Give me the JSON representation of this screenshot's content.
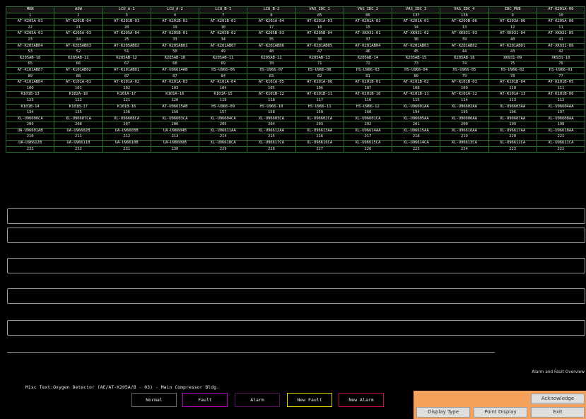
{
  "grid": {
    "rows": [
      [
        "MON",
        "ASW",
        "LCU_A-1",
        "LCU_A-2",
        "LCU_B-1",
        "LCU_B-2",
        "VAS_IDC_1",
        "VAS_IDC_2",
        "VAS_IDC_3",
        "VAS_IDC_4",
        "IDC_PUB",
        "AT-K201A-06"
      ],
      [
        "1",
        "2",
        "3",
        "4",
        "7",
        "8",
        "85",
        "86",
        "137",
        "138",
        "9",
        "10"
      ],
      [
        "AT-K205A-01",
        "AT-K201B-04",
        "AT-K201B-03",
        "AT-K201B-02",
        "AT-K201B-01",
        "AT-K201A-04",
        "AT-K201A-03",
        "AT-K201A-02",
        "AT-K201A-01",
        "AT-K203B-06",
        "AT-K203A-06",
        "AT-K205A-06"
      ],
      [
        "22",
        "21",
        "20",
        "19",
        "18",
        "17",
        "16",
        "15",
        "14",
        "13",
        "12",
        "11"
      ],
      [
        "AT-K205A-01",
        "AT-K205A-03",
        "AT-K205A-04",
        "AT-K205B-01",
        "AT-K205B-02",
        "AT-K205B-03",
        "AT-K205B-04",
        "AT-XK931-01",
        "AT-XK931-02",
        "AT-XK931-03",
        "AT-XK931-04",
        "AT-XK931-05"
      ],
      [
        "23",
        "24",
        "25",
        "33",
        "34",
        "35",
        "36",
        "37",
        "38",
        "39",
        "40",
        "41"
      ],
      [
        "AT-K205AB04",
        "AT-K205AB03",
        "AT-K205AB02",
        "AT-K205AB01",
        "AT-K201AB07",
        "AT-K201AB06",
        "AT-K201AB05",
        "AT-K201AB04",
        "AT-K201AB03",
        "AT-K201AB02",
        "AT-K201AB01",
        "AT-XK931-06"
      ],
      [
        "53",
        "52",
        "51",
        "50",
        "49",
        "48",
        "47",
        "46",
        "45",
        "44",
        "43",
        "42"
      ],
      [
        "K205AB-16",
        "K205AB-11",
        "K205AB-12",
        "K205AB-10",
        "K205AB-11",
        "K205AB-12",
        "K205AB-13",
        "K205AB-14",
        "K205AB-15",
        "K205AB-16",
        "XK931-09",
        "XK931-10"
      ],
      [
        "65",
        "66",
        "67",
        "68",
        "69",
        "70",
        "71",
        "72",
        "73",
        "74",
        "75",
        "76"
      ],
      [
        "AT-K101AB07",
        "AT-K101AB02",
        "AT-K101AB01",
        "AT-U96614AB",
        "HS-U966-06",
        "HS-U966-07",
        "HS-U966-08",
        "HS-U966-03",
        "HS-U966-04",
        "HS-U966-05",
        "HS-U966-02",
        "HS-U966-01"
      ],
      [
        "89",
        "88",
        "87",
        "87",
        "84",
        "83",
        "82",
        "81",
        "80",
        "79",
        "78",
        "77"
      ],
      [
        "AT-K101AB04",
        "AT-K101A-01",
        "AT-K101A-02",
        "AT-K101A-03",
        "AT-K101A-04",
        "AT-K101A-05",
        "AT-K101A-06",
        "AT-K101B-01",
        "AT-K101B-02",
        "AT-K101B-03",
        "AT-K101B-04",
        "AT-K101B-05"
      ],
      [
        "100",
        "101",
        "102",
        "103",
        "104",
        "105",
        "106",
        "107",
        "108",
        "109",
        "110",
        "111"
      ],
      [
        "K101B-13",
        "K102A-18",
        "K101A-17",
        "K101A-16",
        "K101A-15",
        "AT-K101B-12",
        "AT-K101B-11",
        "AT-K101B-10",
        "AT-K101B-11",
        "AT-K101A-12",
        "AT-K101A-13",
        "AT-K101B-06"
      ],
      [
        "123",
        "122",
        "121",
        "120",
        "119",
        "118",
        "117",
        "116",
        "115",
        "114",
        "113",
        "112"
      ],
      [
        "K101B-14",
        "K101B-17",
        "K101B-16",
        "AT-U96615AB",
        "HS-U966-09",
        "HS-U966-10",
        "HS-U966-11",
        "HS-U966-12",
        "XL-U96601AA",
        "XL-U96602AA",
        "XL-U96603AA",
        "XL-U96604AA"
      ],
      [
        "134",
        "135",
        "136",
        "156",
        "157",
        "158",
        "159",
        "160",
        "194",
        "195",
        "196",
        "197"
      ],
      [
        "XL-U96606CA",
        "XL-U96607CA",
        "XL-U96608CA",
        "XL-U96603CA",
        "XL-U96604CA",
        "XL-U96603CA",
        "XL-U96602CA",
        "XL-U96601CA",
        "XL-U96605AA",
        "XL-U96606AA",
        "XL-U96607AA",
        "XL-U96608AA"
      ],
      [
        "209",
        "208",
        "207",
        "206",
        "205",
        "204",
        "203",
        "202",
        "201",
        "200",
        "199",
        "198"
      ],
      [
        "UA-U96601AB",
        "UA-U96602B",
        "UA-U96603B",
        "UA-U96604B",
        "XL-U96611AA",
        "XL-U96612AA",
        "XL-U96613AA",
        "XL-U96614AA",
        "XL-U96615AA",
        "XL-U96616AA",
        "XL-U96617AA",
        "XL-U96618AA"
      ],
      [
        "210",
        "211",
        "212",
        "213",
        "214",
        "215",
        "216",
        "217",
        "218",
        "219",
        "220",
        "221"
      ],
      [
        "UA-U96612B",
        "UA-U96611B",
        "UA-U96610B",
        "UA-U96609B",
        "XL-U96618CA",
        "XL-U96617CA",
        "XL-U96616CA",
        "XL-U96615CA",
        "XL-U96614CA",
        "XL-U96613CA",
        "XL-U96612CA",
        "XL-U96611CA"
      ],
      [
        "233",
        "232",
        "231",
        "230",
        "229",
        "228",
        "227",
        "226",
        "223",
        "224",
        "223",
        "222"
      ]
    ]
  },
  "status": {
    "misc_text": "Misc Text:Oxygen Detector (AE/AT-K205A/B - 03) - Main Compressor Bldg.",
    "alarm_overview": "Alarm and Fault Overview"
  },
  "legend": [
    {
      "label": "Normal",
      "color": "#000000",
      "border": "#6b6b6b"
    },
    {
      "label": "Fault",
      "color": "#000000",
      "border": "#b000c0"
    },
    {
      "label": "Alarm",
      "color": "#000000",
      "border": "#5a1060"
    },
    {
      "label": "New Fault",
      "color": "#000000",
      "border": "#e0d000"
    },
    {
      "label": "New Alarm",
      "color": "#000000",
      "border": "#c01040"
    }
  ],
  "panel": {
    "acknowledge": "Acknowledge",
    "display_type": "Display Type",
    "point_display": "Point Display",
    "exit": "Exit"
  },
  "colors": {
    "grid_border": "#2e6b2e",
    "panel_bg": "#f4a15c",
    "background": "#000000"
  }
}
